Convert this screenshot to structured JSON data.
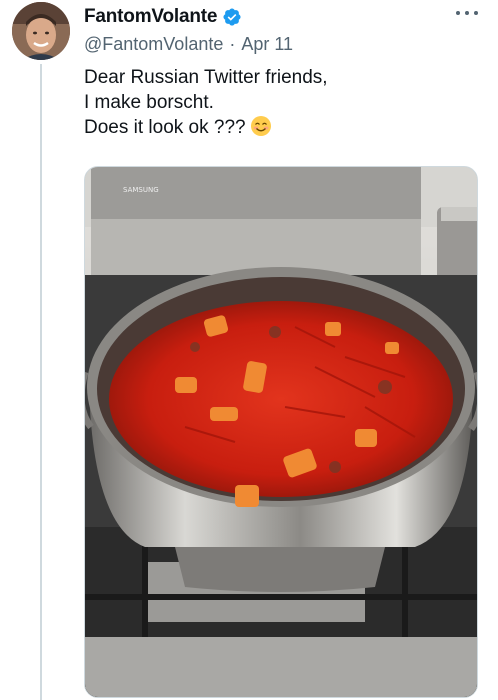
{
  "tweet": {
    "display_name": "FantomVolante",
    "handle": "@FantomVolante",
    "date": "Apr 11",
    "separator": "·",
    "lines": [
      "Dear Russian Twitter friends,",
      "I make borscht.",
      "Does it look ok ???"
    ],
    "emoji": "smiling-face-emoji",
    "verified": true
  },
  "icons": {
    "verified": "verified-badge-icon",
    "more": "more-options-icon"
  },
  "colors": {
    "verified_blue": "#1d9bf0",
    "text_primary": "#0f1419",
    "text_secondary": "#536471",
    "borscht_red": "#c81e0f"
  },
  "media": {
    "description_label": "photo of borscht in pot on stove",
    "brand_mark": "SAMSUNG"
  }
}
